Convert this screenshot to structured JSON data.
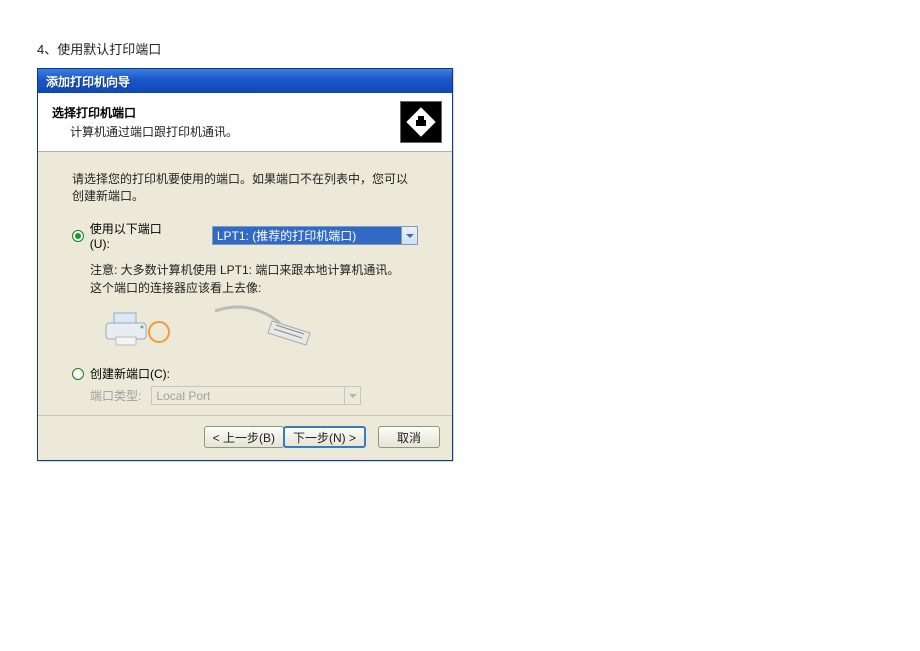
{
  "page": {
    "caption": "4、使用默认打印端口"
  },
  "wizard": {
    "title": "添加打印机向导",
    "header": {
      "title": "选择打印机端口",
      "subtitle": "计算机通过端口跟打印机通讯。",
      "icon_name": "printer-diamond-icon"
    },
    "instruction": "请选择您的打印机要使用的端口。如果端口不在列表中，您可以创建新端口。",
    "use_port": {
      "label": "使用以下端口(U):",
      "selected_value": "LPT1: (推荐的打印机端口)",
      "checked": true
    },
    "note": "注意: 大多数计算机使用 LPT1: 端口来跟本地计算机通讯。这个端口的连接器应该看上去像:",
    "create_port": {
      "label": "创建新端口(C):",
      "checked": false,
      "type_label": "端口类型:",
      "type_value": "Local Port"
    },
    "buttons": {
      "back": "< 上一步(B)",
      "next": "下一步(N) >",
      "cancel": "取消"
    }
  }
}
